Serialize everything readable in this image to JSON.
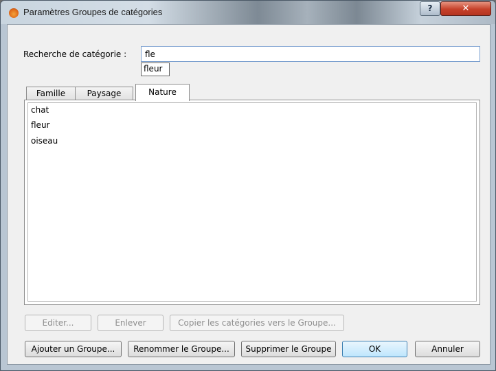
{
  "window": {
    "title": "Paramètres Groupes de catégories",
    "help_glyph": "?",
    "close_glyph": "✕"
  },
  "search": {
    "label": "Recherche de catégorie :",
    "value": "fle",
    "suggestion": "fleur"
  },
  "tabs": [
    {
      "label": "Famille"
    },
    {
      "label": "Paysage"
    },
    {
      "label": "Nature",
      "selected": true
    }
  ],
  "categories": [
    "chat",
    "fleur",
    "oiseau"
  ],
  "actions": {
    "edit": "Editer...",
    "remove": "Enlever",
    "copy_to_group": "Copier les catégories vers le Groupe..."
  },
  "group_actions": {
    "add": "Ajouter un Groupe...",
    "rename": "Renommer le Groupe...",
    "delete": "Supprimer le Groupe",
    "ok": "OK",
    "cancel": "Annuler"
  }
}
